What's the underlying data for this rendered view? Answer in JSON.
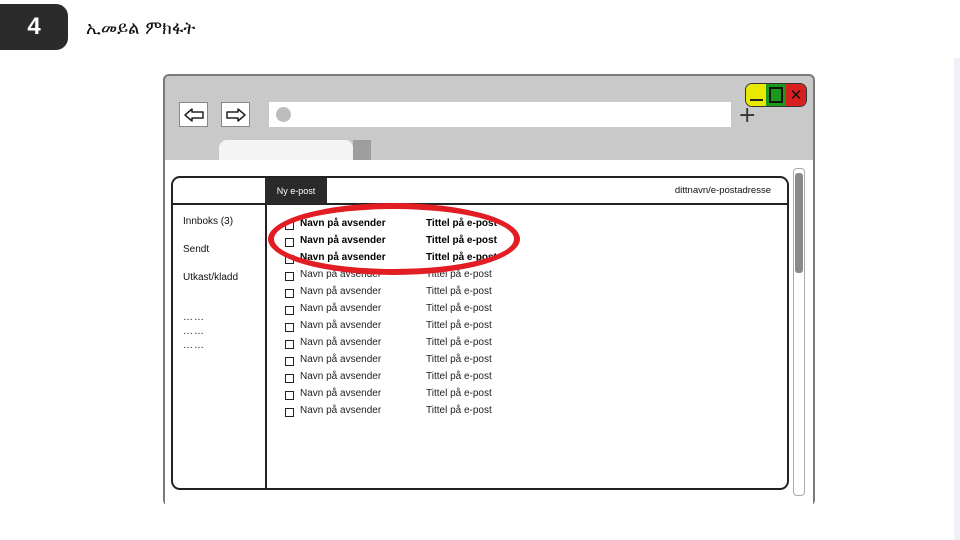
{
  "slide": {
    "step_number": "4",
    "title": "ኢመይል ምክፋት"
  },
  "browser": {
    "controls": {
      "close_glyph": "✕"
    },
    "new_tab_glyph": "+"
  },
  "mail": {
    "compose_label": "Ny e-post",
    "user_address": "dittnavn/e-postadresse",
    "folders": [
      {
        "label": "Innboks (3)"
      },
      {
        "label": "Sendt"
      },
      {
        "label": "Utkast/kladd"
      }
    ],
    "more_items": [
      "……",
      "……",
      "……"
    ],
    "messages": [
      {
        "sender": "Navn på avsender",
        "subject": "Tittel på e-post",
        "unread": true
      },
      {
        "sender": "Navn på avsender",
        "subject": "Tittel på e-post",
        "unread": true
      },
      {
        "sender": "Navn på avsender",
        "subject": "Tittel på e-post",
        "unread": true
      },
      {
        "sender": "Navn på avsender",
        "subject": "Tittel på e-post",
        "unread": false
      },
      {
        "sender": "Navn på avsender",
        "subject": "Tittel på e-post",
        "unread": false
      },
      {
        "sender": "Navn på avsender",
        "subject": "Tittel på e-post",
        "unread": false
      },
      {
        "sender": "Navn på avsender",
        "subject": "Tittel på e-post",
        "unread": false
      },
      {
        "sender": "Navn på avsender",
        "subject": "Tittel på e-post",
        "unread": false
      },
      {
        "sender": "Navn på avsender",
        "subject": "Tittel på e-post",
        "unread": false
      },
      {
        "sender": "Navn på avsender",
        "subject": "Tittel på e-post",
        "unread": false
      },
      {
        "sender": "Navn på avsender",
        "subject": "Tittel på e-post",
        "unread": false
      },
      {
        "sender": "Navn på avsender",
        "subject": "Tittel på e-post",
        "unread": false
      }
    ]
  },
  "colors": {
    "highlight": "#e21d24",
    "minimize": "#e8e800",
    "maximize": "#1a9a1a",
    "close": "#d82020"
  }
}
